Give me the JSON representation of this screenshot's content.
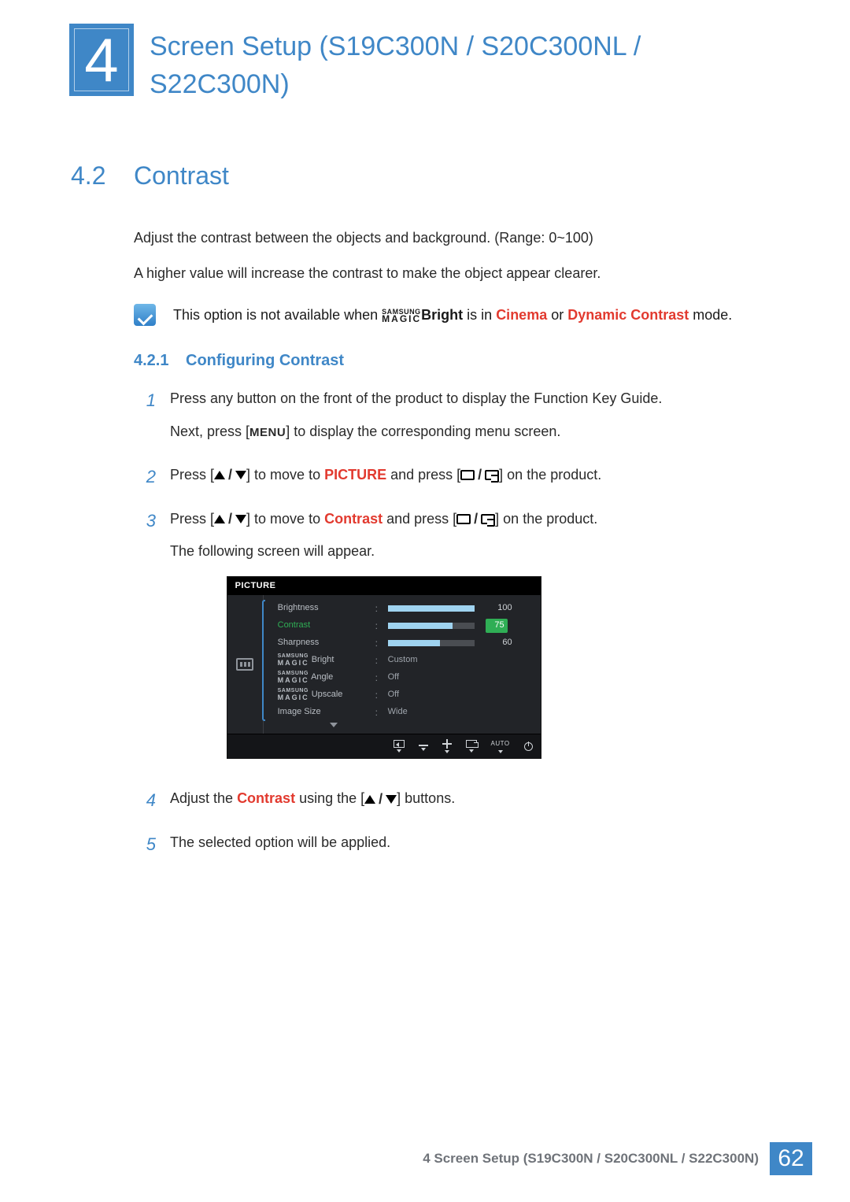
{
  "chapter": {
    "number": "4",
    "title": "Screen Setup (S19C300N / S20C300NL / S22C300N)"
  },
  "section": {
    "number": "4.2",
    "title": "Contrast"
  },
  "intro": {
    "p1": "Adjust the contrast between the objects and background. (Range: 0~100)",
    "p2": "A higher value will increase the contrast to make the object appear clearer."
  },
  "note": {
    "pre": "This option is not available when ",
    "magic_top": "SAMSUNG",
    "magic_bot": "MAGIC",
    "bright_word": "Bright",
    "mid": " is in ",
    "cinema": "Cinema",
    "or": " or ",
    "dyn": "Dynamic Contrast",
    "post": " mode."
  },
  "subsection": {
    "number": "4.2.1",
    "title": "Configuring Contrast"
  },
  "steps": {
    "s1": {
      "n": "1",
      "a": "Press any button on the front of the product to display the Function Key Guide.",
      "b_pre": "Next, press [",
      "menu": "MENU",
      "b_post": "] to display the corresponding menu screen."
    },
    "s2": {
      "n": "2",
      "pre": "Press [",
      "mid": "] to move to ",
      "target": "PICTURE",
      "mid2": " and press [",
      "post": "] on the product."
    },
    "s3": {
      "n": "3",
      "pre": "Press [",
      "mid": "] to move to ",
      "target": "Contrast",
      "mid2": " and press [",
      "post": "] on the product.",
      "tail": "The following screen will appear."
    },
    "s4": {
      "n": "4",
      "pre": "Adjust the ",
      "target": "Contrast",
      "mid": " using the [",
      "post": "] buttons."
    },
    "s5": {
      "n": "5",
      "text": "The selected option will be applied."
    }
  },
  "osd": {
    "header": "PICTURE",
    "rows": [
      {
        "label": "Brightness",
        "slider": 100,
        "value": "100"
      },
      {
        "label": "Contrast",
        "slider": 75,
        "value": "75",
        "selected": true
      },
      {
        "label": "Sharpness",
        "slider": 60,
        "value": "60"
      },
      {
        "label_magic_suffix": "Bright",
        "text": "Custom"
      },
      {
        "label_magic_suffix": "Angle",
        "text": "Off"
      },
      {
        "label_magic_suffix": "Upscale",
        "text": "Off"
      },
      {
        "label": "Image Size",
        "text": "Wide"
      }
    ],
    "footer_auto": "AUTO"
  },
  "footer": {
    "text": "4 Screen Setup (S19C300N / S20C300NL / S22C300N)",
    "page": "62"
  }
}
